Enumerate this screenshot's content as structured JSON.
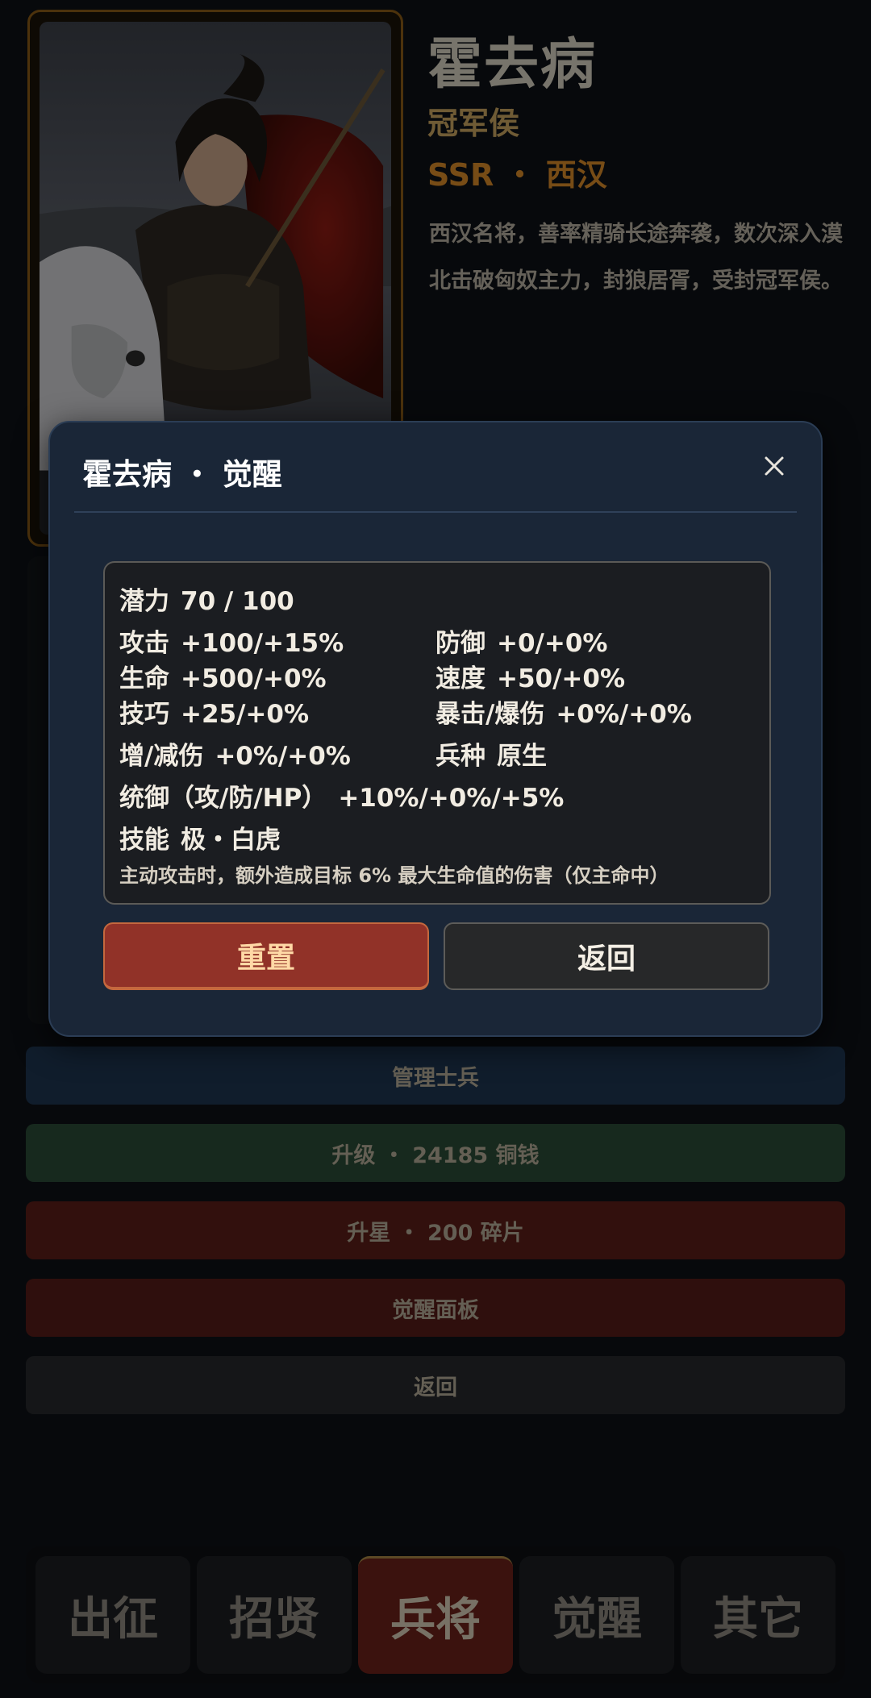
{
  "hero": {
    "name": "霍去病",
    "title": "冠军侯",
    "rarity": "SSR ・ 西汉",
    "description": "西汉名将，善率精骑长途奔袭，数次深入漠北击破匈奴主力，封狼居胥，受封冠军侯。"
  },
  "actions": {
    "manage_soldiers": "管理士兵",
    "upgrade": "升级 ・ 24185 铜钱",
    "star_up": "升星 ・ 200 碎片",
    "awaken_panel": "觉醒面板",
    "back": "返回"
  },
  "modal": {
    "title": "霍去病 ・ 觉醒",
    "stats": {
      "potential": {
        "label": "潜力",
        "value": "70 / 100"
      },
      "attack": {
        "label": "攻击",
        "value": "+100/+15%"
      },
      "defense": {
        "label": "防御",
        "value": "+0/+0%"
      },
      "hp": {
        "label": "生命",
        "value": "+500/+0%"
      },
      "speed": {
        "label": "速度",
        "value": "+50/+0%"
      },
      "skill_stat": {
        "label": "技巧",
        "value": "+25/+0%"
      },
      "crit": {
        "label": "暴击/爆伤",
        "value": "+0%/+0%"
      },
      "dmg": {
        "label": "增/减伤",
        "value": "+0%/+0%"
      },
      "troop": {
        "label": "兵种",
        "value": "原生"
      },
      "command": {
        "label": "统御（攻/防/HP）",
        "value": "+10%/+0%/+5%"
      },
      "skill": {
        "label": "技能",
        "value": "极・白虎"
      }
    },
    "skill_description": "主动攻击时，额外造成目标 6% 最大生命值的伤害（仅主命中）",
    "reset_label": "重置",
    "return_label": "返回"
  },
  "nav": {
    "tabs": [
      "出征",
      "招贤",
      "兵将",
      "觉醒",
      "其它"
    ],
    "active_index": 2
  }
}
